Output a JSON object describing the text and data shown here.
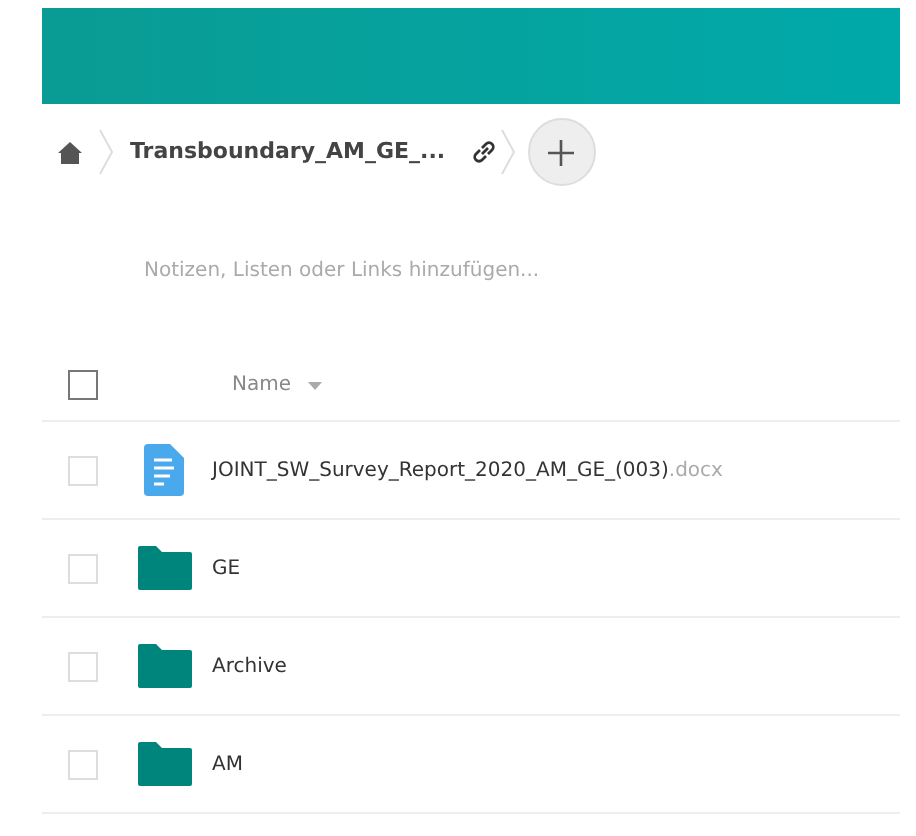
{
  "breadcrumb": {
    "folder": "Transboundary_AM_GE_..."
  },
  "description": {
    "placeholder": "Notizen, Listen oder Links hinzufügen..."
  },
  "table": {
    "header": {
      "checked": false,
      "name_column": "Name"
    },
    "rows": [
      {
        "kind": "file",
        "name": "JOINT_SW_Survey_Report_2020_AM_GE_(003)",
        "extension": ".docx",
        "checked": false
      },
      {
        "kind": "folder",
        "name": "GE",
        "checked": false
      },
      {
        "kind": "folder",
        "name": "Archive",
        "checked": false
      },
      {
        "kind": "folder",
        "name": "AM",
        "checked": false
      }
    ]
  }
}
